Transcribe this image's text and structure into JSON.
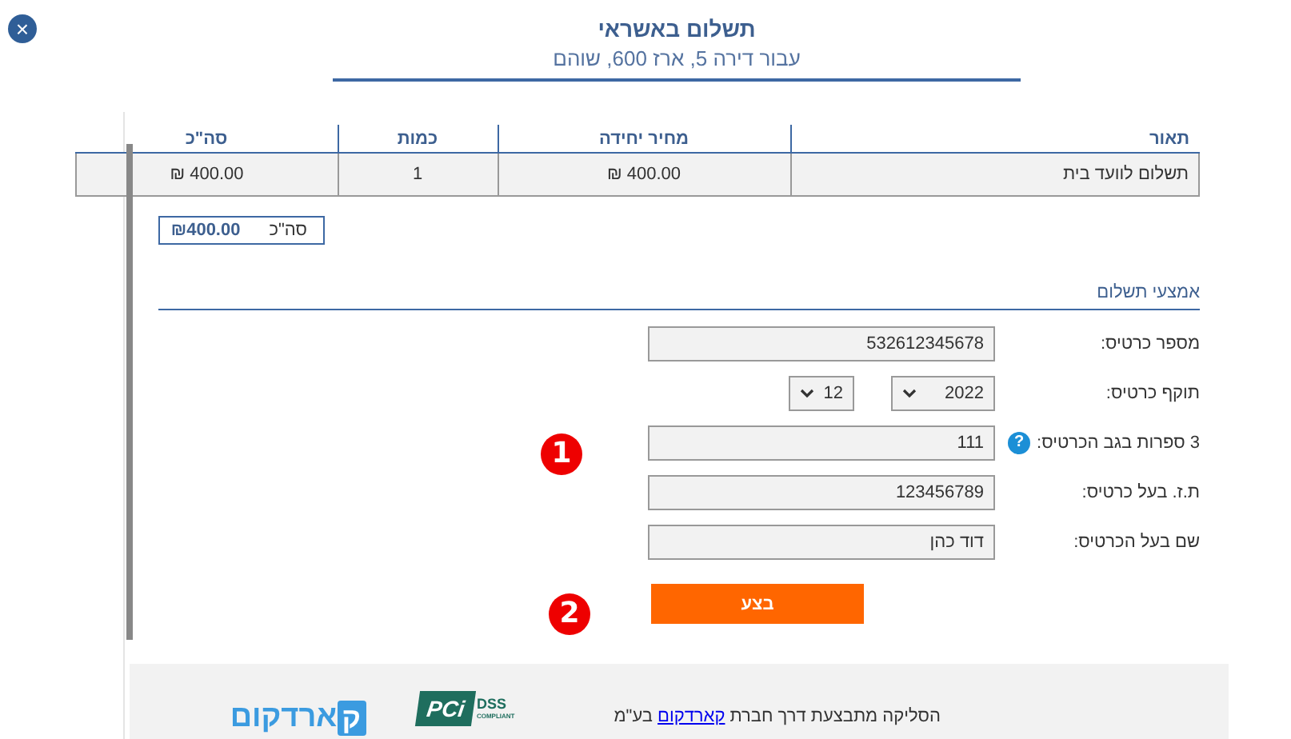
{
  "header": {
    "close_button": "×",
    "title": "תשלום באשראי",
    "subtitle": "עבור דירה 5, ארז 600, שוהם"
  },
  "table": {
    "columns": [
      "תאור",
      "מחיר יחידה",
      "כמות",
      "סה\"כ"
    ],
    "rows": [
      [
        "תשלום לוועד בית",
        "400.00 ₪",
        "1",
        "400.00 ₪"
      ]
    ]
  },
  "total": {
    "label": "סה\"כ",
    "value": "₪400.00"
  },
  "payment": {
    "title": "אמצעי תשלום",
    "fields": [
      {
        "kind": "text",
        "label": "מספר כרטיס:",
        "value": "532612345678"
      },
      {
        "kind": "select",
        "label": "תוקף כרטיס:",
        "selects": [
          "2022",
          "12"
        ]
      },
      {
        "kind": "text",
        "label": "3 ספרות בגב הכרטיס:",
        "help": "?",
        "value": "111"
      },
      {
        "kind": "text",
        "label": "ת.ז. בעל כרטיס:",
        "value": "123456789"
      },
      {
        "kind": "text",
        "label": "שם בעל הכרטיס:",
        "value": "דוד כהן"
      }
    ],
    "submit_button": "בצע"
  },
  "annotations": [
    "1",
    "2"
  ],
  "footer": {
    "text_before": "הסליקה מתבצעת דרך חברת",
    "link": "קארדקום",
    "text_after": "בע\"מ",
    "pci_logo": {
      "mark": "PCi",
      "label": "DSS",
      "sub": "COMPLIANT"
    },
    "brand_logo": {
      "mark": "ק",
      "text": "ארדקום"
    }
  }
}
